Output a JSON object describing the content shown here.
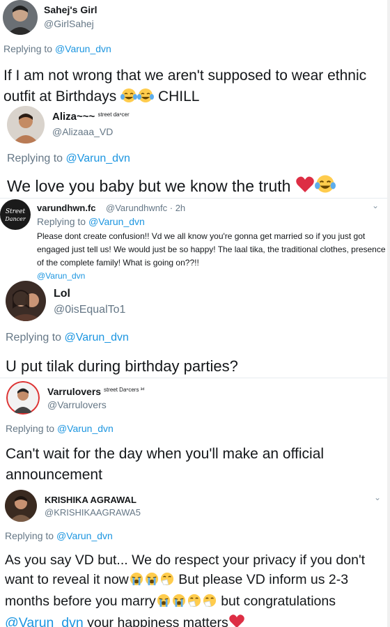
{
  "tweets": [
    {
      "name": "Sahej's Girl",
      "handle": "@GirlSahej",
      "replying_prefix": "Replying to ",
      "replying_to": "@Varun_dvn",
      "text": "If I am not wrong that we aren't supposed to wear ethnic outfit at Birthdays",
      "text_end": "CHILL",
      "emojis": [
        "face-with-tears-of-joy",
        "face-with-tears-of-joy"
      ]
    },
    {
      "name": "Aliza~~~",
      "name_tiny": "street daⁿcer",
      "handle": "@Alizaaa_VD",
      "replying_prefix": "Replying to ",
      "replying_to": "@Varun_dvn",
      "text": "We love you baby but we know the truth",
      "emojis": [
        "red-heart",
        "face-with-tears-of-joy"
      ]
    },
    {
      "name": "varundhwn.fc",
      "handle": "@Varundhwnfc",
      "time": "· 2h",
      "replying_prefix": "Replying to ",
      "replying_to": "@Varun_dvn",
      "text": "Please dont create confusion!! Vd we all know you're gonna get married so if you just got engaged just tell us! We would just be so happy! The laal tika, the traditional clothes, presence of the complete family! What is going on??!!",
      "mention_end": "@Varun_dvn"
    },
    {
      "name": "Lol",
      "handle": "@0isEqualTo1",
      "replying_prefix": "Replying to ",
      "replying_to": "@Varun_dvn",
      "text": "U put tilak during birthday parties?"
    },
    {
      "name": "Varrulovers",
      "name_tiny": "street Daⁿcers ³ᵈ",
      "handle": "@Varrulovers",
      "replying_prefix": "Replying to ",
      "replying_to": "@Varun_dvn",
      "text": "Can't wait for the day when you'll make an official announcement"
    },
    {
      "name": "KRISHIKA AGRAWAL",
      "handle": "@KRISHIKAAGRAWA5",
      "replying_prefix": "Replying to ",
      "replying_to": "@Varun_dvn",
      "text_1": "As you say VD but... We do respect your privacy if you don't want to reveal it now",
      "text_2": "But please VD inform us 2-3 months before you marry",
      "text_3": "but congratulations",
      "mention": "@Varun_dvn",
      "text_4": "your happiness matters"
    }
  ],
  "colors": {
    "mention": "#1b95e0",
    "secondary": "#657786",
    "primary": "#14171a",
    "heart": "#e0245e"
  }
}
